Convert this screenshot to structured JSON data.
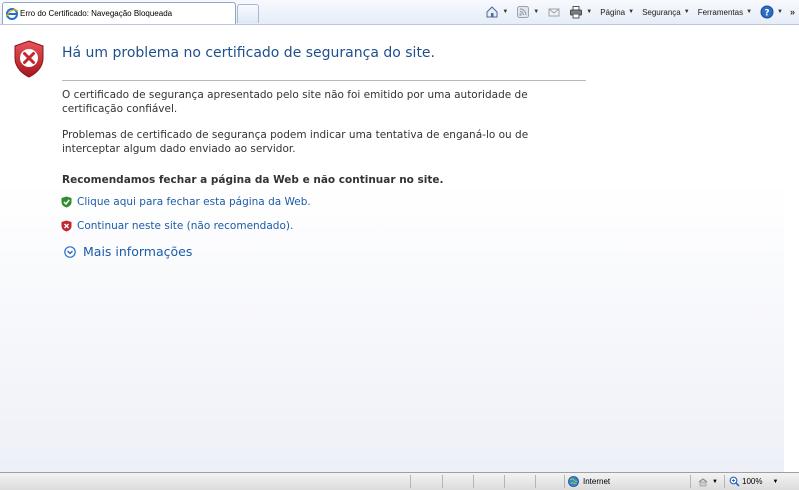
{
  "tab": {
    "title": "Erro do Certificado: Navegação Bloqueada"
  },
  "commandbar": {
    "pagina": "Página",
    "seguranca": "Segurança",
    "ferramentas": "Ferramentas",
    "chevron": "»"
  },
  "content": {
    "title": "Há um problema no certificado de segurança do site.",
    "paragraph1": "O certificado de segurança apresentado pelo site não foi emitido por uma autoridade de certificação confiável.",
    "paragraph2": "Problemas de certificado de segurança podem indicar uma tentativa de enganá-lo ou de interceptar algum dado enviado ao servidor.",
    "recommendation": "Recomendamos fechar a página da Web e não continuar no site.",
    "close_link": "Clique aqui para fechar esta página da Web.",
    "continue_link": "Continuar neste site (não recomendado).",
    "more_info": "Mais informações"
  },
  "statusbar": {
    "zone": "Internet",
    "zoom": "100%"
  },
  "colors": {
    "title": "#1f4f8f",
    "link": "#1c5ca8",
    "shield_red": "#c4262e",
    "shield_green": "#2f8f2f"
  }
}
